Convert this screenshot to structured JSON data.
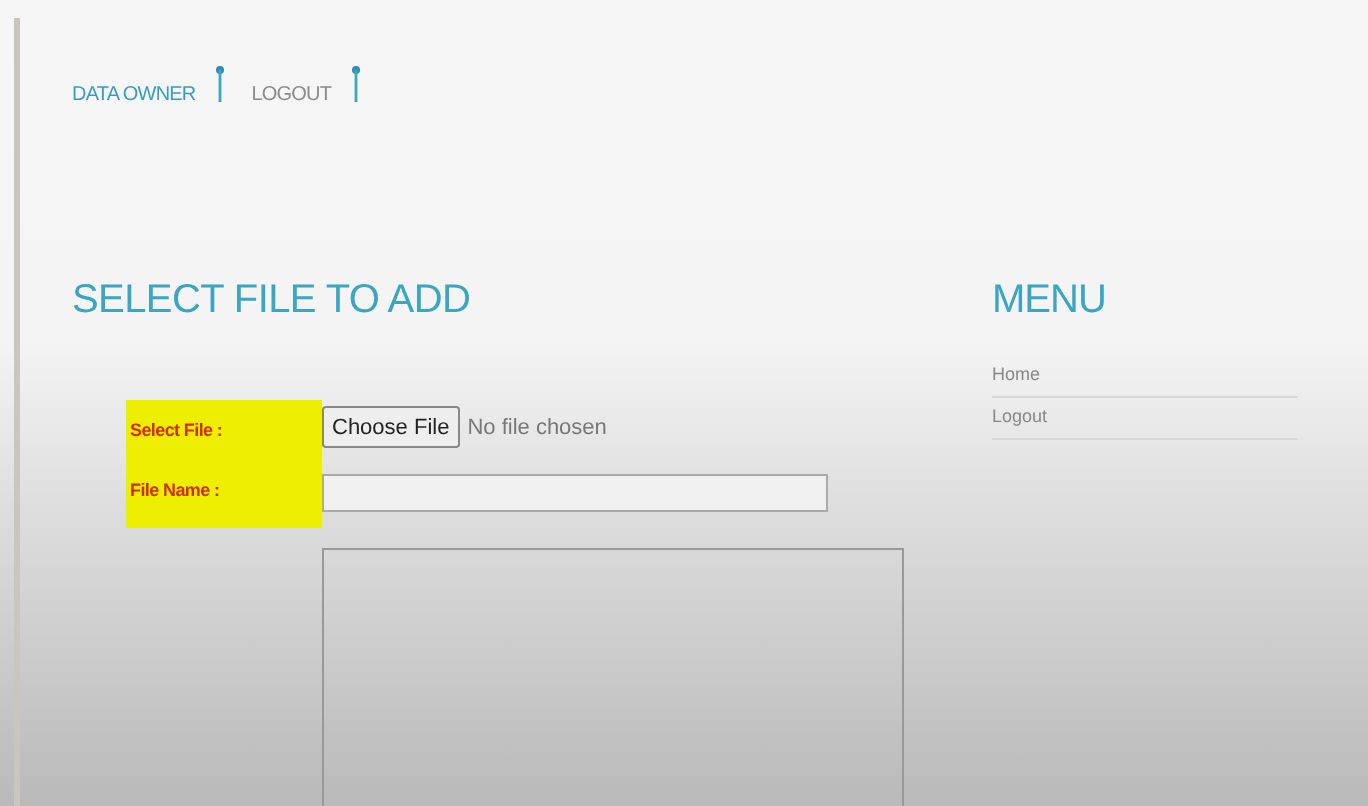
{
  "nav": [
    {
      "label": "DATA OWNER",
      "selected": true
    },
    {
      "label": "LOGOUT",
      "selected": false
    }
  ],
  "title": "SELECT FILE TO ADD",
  "form": {
    "select_label": "Select File :",
    "choose_button": "Choose File",
    "file_status": "No file chosen",
    "name_label": "File Name :"
  },
  "menu": {
    "title": "MENU",
    "items": [
      "Home",
      "Logout"
    ]
  }
}
